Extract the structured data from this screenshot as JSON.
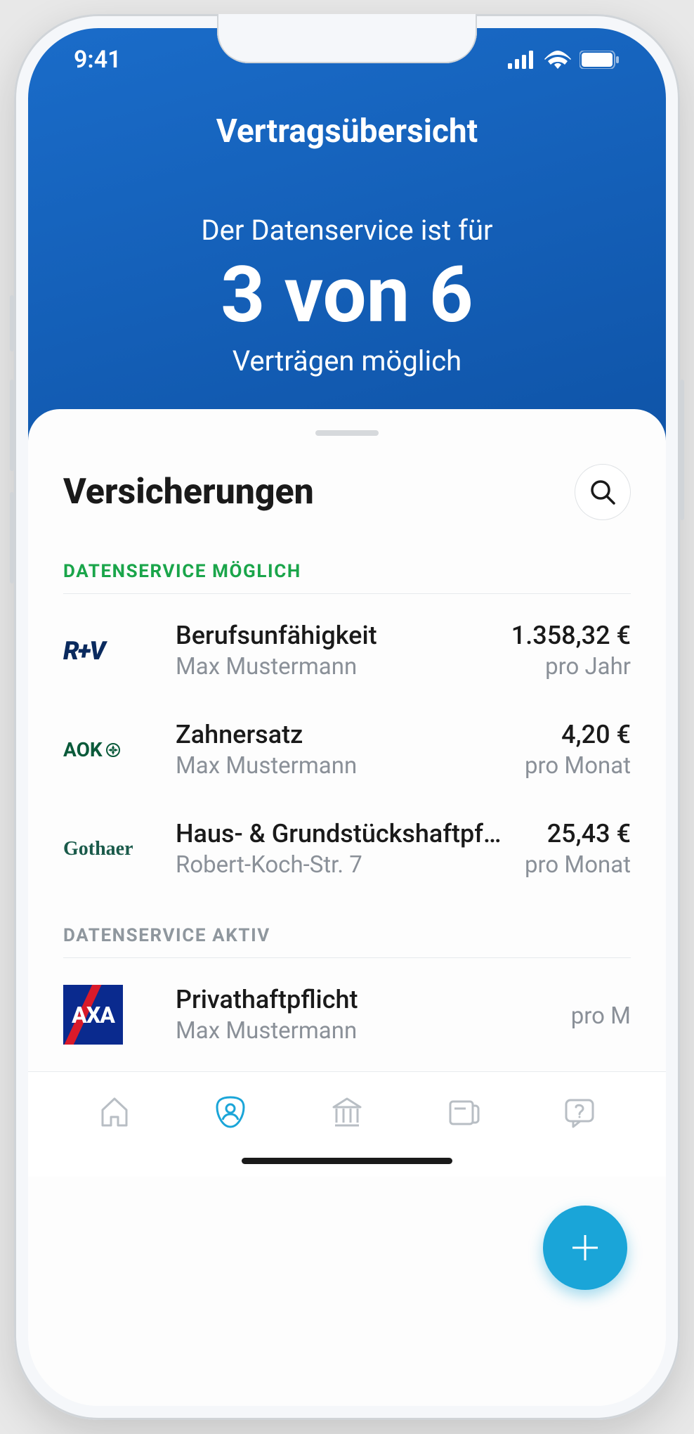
{
  "status": {
    "time": "9:41"
  },
  "header": {
    "title": "Vertragsübersicht",
    "line1": "Der Datenservice ist für",
    "big": "3 von 6",
    "line2": "Verträgen möglich"
  },
  "sheet": {
    "title": "Versicherungen"
  },
  "sections": [
    {
      "label": "DATENSERVICE MÖGLICH",
      "color": "green",
      "items": [
        {
          "logo": "rv",
          "logo_text": "R+V",
          "title": "Berufsunfähigkeit",
          "sub": "Max Mustermann",
          "amount": "1.358,32 €",
          "period": "pro Jahr"
        },
        {
          "logo": "aok",
          "logo_text": "AOK",
          "title": "Zahnersatz",
          "sub": "Max Mustermann",
          "amount": "4,20 €",
          "period": "pro Monat"
        },
        {
          "logo": "gothaer",
          "logo_text": "Gothaer",
          "title": "Haus- & Grundstückshaftpf...",
          "sub": "Robert-Koch-Str. 7",
          "amount": "25,43 €",
          "period": "pro Monat"
        }
      ]
    },
    {
      "label": "DATENSERVICE AKTIV",
      "color": "grey",
      "items": [
        {
          "logo": "axa",
          "logo_text": "AXA",
          "title": "Privathaftpflicht",
          "sub": "Max Mustermann",
          "amount": "",
          "period": "pro M"
        }
      ]
    }
  ],
  "tabs": [
    "home",
    "profile",
    "bank",
    "card",
    "help"
  ]
}
